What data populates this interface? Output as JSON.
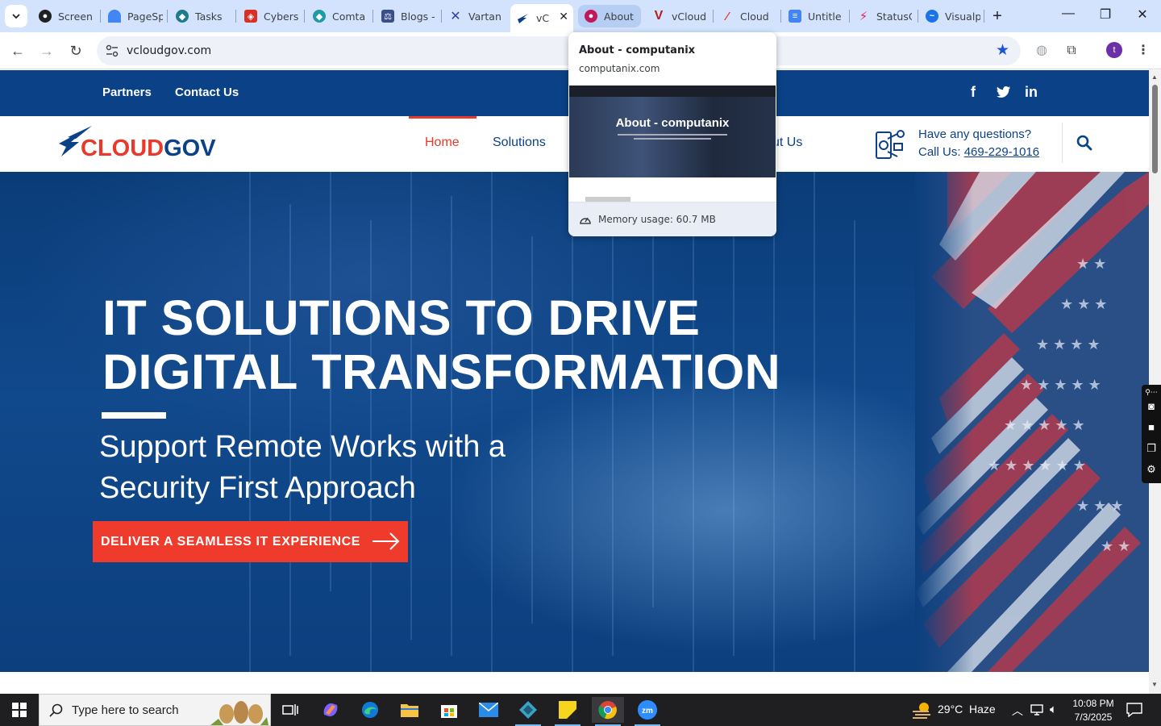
{
  "browser": {
    "tabs": [
      {
        "title": "Screen",
        "icon": "screencast-icon",
        "color": "#202124"
      },
      {
        "title": "PageSp",
        "icon": "pagespeed-icon",
        "color": "#4285f4"
      },
      {
        "title": "Tasks",
        "icon": "tasks-icon",
        "color": "#1f7a8c"
      },
      {
        "title": "Cybers",
        "icon": "cybersecurity-icon",
        "color": "#d93025"
      },
      {
        "title": "Comta",
        "icon": "comta-icon",
        "color": "#1f9aa6"
      },
      {
        "title": "Blogs -",
        "icon": "scales-icon",
        "color": "#3a4f8a"
      },
      {
        "title": "Vartan",
        "icon": "x-logo-icon",
        "color": "#2b3fb5"
      },
      {
        "title": "vC",
        "icon": "cloudgov-favicon-icon",
        "color": "#0b4187"
      },
      {
        "title": "About",
        "icon": "computanix-icon",
        "color": "#c2185b"
      },
      {
        "title": "vCloud",
        "icon": "v-logo-icon",
        "color": "#b71c1c"
      },
      {
        "title": "Cloud",
        "icon": "cloud-red-icon",
        "color": "#e8392b"
      },
      {
        "title": "Untitle",
        "icon": "docs-icon",
        "color": "#4285f4"
      },
      {
        "title": "StatusC",
        "icon": "status-icon",
        "color": "#e91e63"
      },
      {
        "title": "Visualp",
        "icon": "visualping-icon",
        "color": "#1a73e8"
      }
    ],
    "url": "vcloudgov.com",
    "profile_initial": "t",
    "hover_card": {
      "title": "About - computanix",
      "domain": "computanix.com",
      "preview_title": "About - computanix",
      "memory": "Memory usage: 60.7 MB"
    }
  },
  "site": {
    "topbar": {
      "links": [
        "Partners",
        "Contact Us"
      ]
    },
    "logo": {
      "text_a": "CLOUD",
      "text_b": "GOV"
    },
    "menu": [
      {
        "label": "Home",
        "active": true
      },
      {
        "label": "Solutions",
        "active": false
      },
      {
        "label": "ut Us",
        "active": false
      }
    ],
    "contact": {
      "question": "Have any questions?",
      "call_prefix": "Call Us: ",
      "phone": "469-229-1016"
    },
    "hero": {
      "headline": "IT SOLUTIONS TO DRIVE DIGITAL TRANSFORMATION",
      "subhead": "Support Remote Works with a Security First Approach",
      "cta": "DELIVER A SEAMLESS IT EXPERIENCE"
    }
  },
  "taskbar": {
    "search_placeholder": "Type here to search",
    "weather_temp": "29°C",
    "weather_desc": "Haze",
    "time": "10:08 PM",
    "date": "7/3/2025"
  },
  "colors": {
    "brand_blue": "#0b4187",
    "brand_red": "#e8392b",
    "chrome_tabstrip": "#d3e3fd"
  }
}
